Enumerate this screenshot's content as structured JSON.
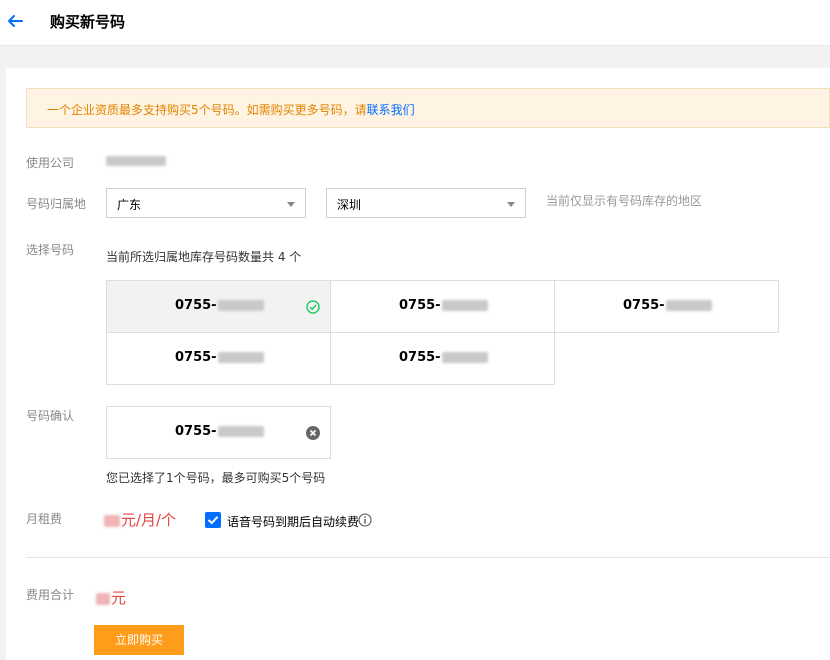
{
  "header": {
    "title": "购买新号码"
  },
  "notice": {
    "text": "一个企业资质最多支持购买5个号码。如需购买更多号码，请",
    "link": "联系我们"
  },
  "form": {
    "company_label": "使用公司",
    "location_label": "号码归属地",
    "province": "广东",
    "city": "深圳",
    "location_hint": "当前仅显示有号码库存的地区",
    "select_label": "选择号码",
    "inventory_text": "当前所选归属地库存号码数量共 4 个",
    "numbers": [
      "0755-",
      "0755-",
      "0755-",
      "0755-",
      "0755-"
    ],
    "confirm_label": "号码确认",
    "confirmed_number": "0755-",
    "selection_note": "您已选择了1个号码，最多可购买5个号码",
    "rent_label": "月租费",
    "rent_unit": "元/月/个",
    "auto_renew_label": "语音号码到期后自动续费",
    "auto_renew_checked": true,
    "total_label": "费用合计",
    "total_unit": "元",
    "buy_button": "立即购买"
  },
  "colors": {
    "accent": "#006eff",
    "warning": "#e38300",
    "price": "#e54545",
    "buy": "#ff9c19",
    "check": "#29cc6a"
  }
}
